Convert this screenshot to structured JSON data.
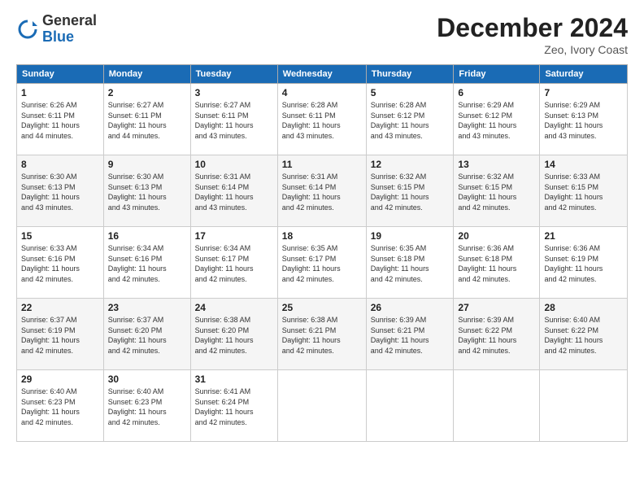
{
  "logo": {
    "general": "General",
    "blue": "Blue"
  },
  "title": "December 2024",
  "location": "Zeo, Ivory Coast",
  "days_of_week": [
    "Sunday",
    "Monday",
    "Tuesday",
    "Wednesday",
    "Thursday",
    "Friday",
    "Saturday"
  ],
  "weeks": [
    [
      {
        "day": "1",
        "sunrise": "6:26 AM",
        "sunset": "6:11 PM",
        "daylight": "11 hours and 44 minutes."
      },
      {
        "day": "2",
        "sunrise": "6:27 AM",
        "sunset": "6:11 PM",
        "daylight": "11 hours and 44 minutes."
      },
      {
        "day": "3",
        "sunrise": "6:27 AM",
        "sunset": "6:11 PM",
        "daylight": "11 hours and 43 minutes."
      },
      {
        "day": "4",
        "sunrise": "6:28 AM",
        "sunset": "6:11 PM",
        "daylight": "11 hours and 43 minutes."
      },
      {
        "day": "5",
        "sunrise": "6:28 AM",
        "sunset": "6:12 PM",
        "daylight": "11 hours and 43 minutes."
      },
      {
        "day": "6",
        "sunrise": "6:29 AM",
        "sunset": "6:12 PM",
        "daylight": "11 hours and 43 minutes."
      },
      {
        "day": "7",
        "sunrise": "6:29 AM",
        "sunset": "6:13 PM",
        "daylight": "11 hours and 43 minutes."
      }
    ],
    [
      {
        "day": "8",
        "sunrise": "6:30 AM",
        "sunset": "6:13 PM",
        "daylight": "11 hours and 43 minutes."
      },
      {
        "day": "9",
        "sunrise": "6:30 AM",
        "sunset": "6:13 PM",
        "daylight": "11 hours and 43 minutes."
      },
      {
        "day": "10",
        "sunrise": "6:31 AM",
        "sunset": "6:14 PM",
        "daylight": "11 hours and 43 minutes."
      },
      {
        "day": "11",
        "sunrise": "6:31 AM",
        "sunset": "6:14 PM",
        "daylight": "11 hours and 42 minutes."
      },
      {
        "day": "12",
        "sunrise": "6:32 AM",
        "sunset": "6:15 PM",
        "daylight": "11 hours and 42 minutes."
      },
      {
        "day": "13",
        "sunrise": "6:32 AM",
        "sunset": "6:15 PM",
        "daylight": "11 hours and 42 minutes."
      },
      {
        "day": "14",
        "sunrise": "6:33 AM",
        "sunset": "6:15 PM",
        "daylight": "11 hours and 42 minutes."
      }
    ],
    [
      {
        "day": "15",
        "sunrise": "6:33 AM",
        "sunset": "6:16 PM",
        "daylight": "11 hours and 42 minutes."
      },
      {
        "day": "16",
        "sunrise": "6:34 AM",
        "sunset": "6:16 PM",
        "daylight": "11 hours and 42 minutes."
      },
      {
        "day": "17",
        "sunrise": "6:34 AM",
        "sunset": "6:17 PM",
        "daylight": "11 hours and 42 minutes."
      },
      {
        "day": "18",
        "sunrise": "6:35 AM",
        "sunset": "6:17 PM",
        "daylight": "11 hours and 42 minutes."
      },
      {
        "day": "19",
        "sunrise": "6:35 AM",
        "sunset": "6:18 PM",
        "daylight": "11 hours and 42 minutes."
      },
      {
        "day": "20",
        "sunrise": "6:36 AM",
        "sunset": "6:18 PM",
        "daylight": "11 hours and 42 minutes."
      },
      {
        "day": "21",
        "sunrise": "6:36 AM",
        "sunset": "6:19 PM",
        "daylight": "11 hours and 42 minutes."
      }
    ],
    [
      {
        "day": "22",
        "sunrise": "6:37 AM",
        "sunset": "6:19 PM",
        "daylight": "11 hours and 42 minutes."
      },
      {
        "day": "23",
        "sunrise": "6:37 AM",
        "sunset": "6:20 PM",
        "daylight": "11 hours and 42 minutes."
      },
      {
        "day": "24",
        "sunrise": "6:38 AM",
        "sunset": "6:20 PM",
        "daylight": "11 hours and 42 minutes."
      },
      {
        "day": "25",
        "sunrise": "6:38 AM",
        "sunset": "6:21 PM",
        "daylight": "11 hours and 42 minutes."
      },
      {
        "day": "26",
        "sunrise": "6:39 AM",
        "sunset": "6:21 PM",
        "daylight": "11 hours and 42 minutes."
      },
      {
        "day": "27",
        "sunrise": "6:39 AM",
        "sunset": "6:22 PM",
        "daylight": "11 hours and 42 minutes."
      },
      {
        "day": "28",
        "sunrise": "6:40 AM",
        "sunset": "6:22 PM",
        "daylight": "11 hours and 42 minutes."
      }
    ],
    [
      {
        "day": "29",
        "sunrise": "6:40 AM",
        "sunset": "6:23 PM",
        "daylight": "11 hours and 42 minutes."
      },
      {
        "day": "30",
        "sunrise": "6:40 AM",
        "sunset": "6:23 PM",
        "daylight": "11 hours and 42 minutes."
      },
      {
        "day": "31",
        "sunrise": "6:41 AM",
        "sunset": "6:24 PM",
        "daylight": "11 hours and 42 minutes."
      },
      null,
      null,
      null,
      null
    ]
  ],
  "labels": {
    "sunrise": "Sunrise: ",
    "sunset": "Sunset: ",
    "daylight": "Daylight hours"
  }
}
